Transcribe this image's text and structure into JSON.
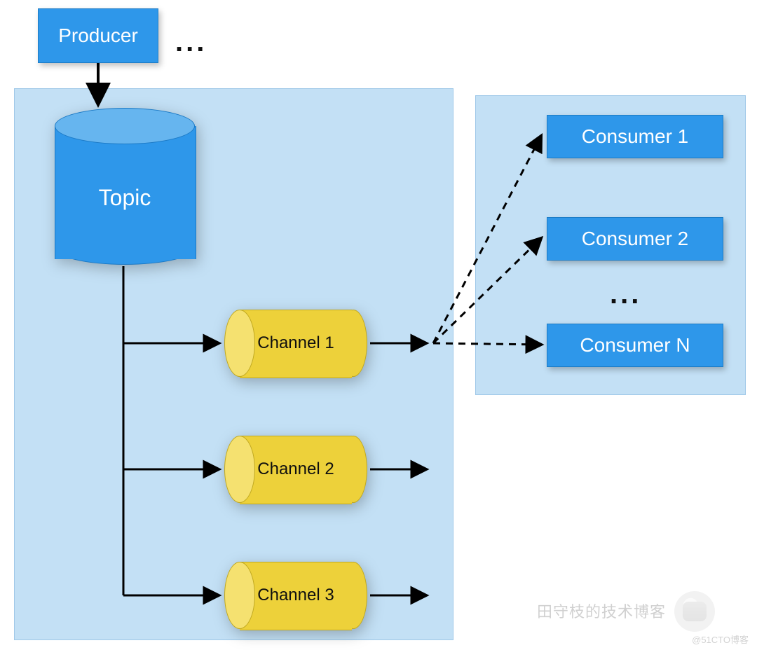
{
  "producer": {
    "label": "Producer"
  },
  "ellipsis": "...",
  "topic": {
    "label": "Topic"
  },
  "channels": [
    {
      "label": "Channel 1"
    },
    {
      "label": "Channel 2"
    },
    {
      "label": "Channel 3"
    }
  ],
  "consumers": [
    {
      "label": "Consumer 1"
    },
    {
      "label": "Consumer 2"
    },
    {
      "label": "Consumer N"
    }
  ],
  "watermark": {
    "text": "田守枝的技术博客",
    "small": "@51CTO博客"
  },
  "colors": {
    "panel": "#c3e0f5",
    "blue": "#2e97ea",
    "blue_dark": "#1c7cc6",
    "yellow": "#edd13a",
    "yellow_light": "#f5e170"
  }
}
